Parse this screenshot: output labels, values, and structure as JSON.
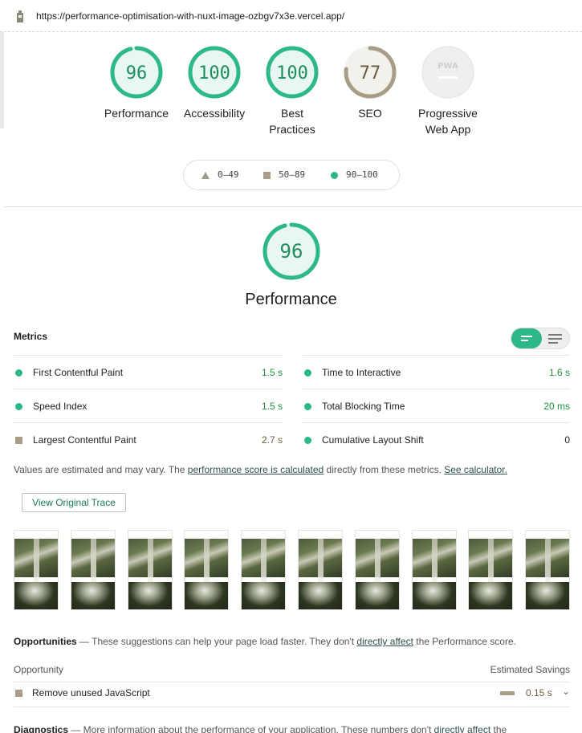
{
  "url": "https://performance-optimisation-with-nuxt-image-ozbgv7x3e.vercel.app/",
  "categories": [
    {
      "score": "96",
      "label": "Performance",
      "value": 96,
      "color": "#2db88a"
    },
    {
      "score": "100",
      "label": "Accessibility",
      "value": 100,
      "color": "#2db88a"
    },
    {
      "score": "100",
      "label": "Best Practices",
      "value": 100,
      "color": "#2db88a"
    },
    {
      "score": "77",
      "label": "SEO",
      "value": 77,
      "color": "#a89d86"
    },
    {
      "score": "PWA",
      "label": "Progressive Web App",
      "value": 0,
      "color": "#d6d6d6"
    }
  ],
  "legend": {
    "fail": "0–49",
    "average": "50–89",
    "pass": "90–100"
  },
  "performance": {
    "score": "96",
    "value": 96,
    "title": "Performance"
  },
  "metrics": {
    "title": "Metrics",
    "left": [
      {
        "name": "First Contentful Paint",
        "value": "1.5 s",
        "status": "pass"
      },
      {
        "name": "Speed Index",
        "value": "1.5 s",
        "status": "pass"
      },
      {
        "name": "Largest Contentful Paint",
        "value": "2.7 s",
        "status": "average"
      }
    ],
    "right": [
      {
        "name": "Time to Interactive",
        "value": "1.6 s",
        "status": "pass"
      },
      {
        "name": "Total Blocking Time",
        "value": "20 ms",
        "status": "pass"
      },
      {
        "name": "Cumulative Layout Shift",
        "value": "0",
        "status": "pass"
      }
    ]
  },
  "note": {
    "prefix": "Values are estimated and may vary. The ",
    "link1": "performance score is calculated",
    "middle": " directly from these metrics. ",
    "link2": "See calculator."
  },
  "trace_button": "View Original Trace",
  "frame_count": 10,
  "opportunities": {
    "title": "Opportunities",
    "desc_prefix": " — These suggestions can help your page load faster. They don't ",
    "desc_link": "directly affect",
    "desc_suffix": " the Performance score.",
    "col_left": "Opportunity",
    "col_right": "Estimated Savings",
    "items": [
      {
        "name": "Remove unused JavaScript",
        "value": "0.15 s"
      }
    ]
  },
  "diagnostics": {
    "title": "Diagnostics",
    "desc_prefix": " — More information about the performance of your application. These numbers don't ",
    "desc_link": "directly affect",
    "desc_suffix": " the"
  }
}
